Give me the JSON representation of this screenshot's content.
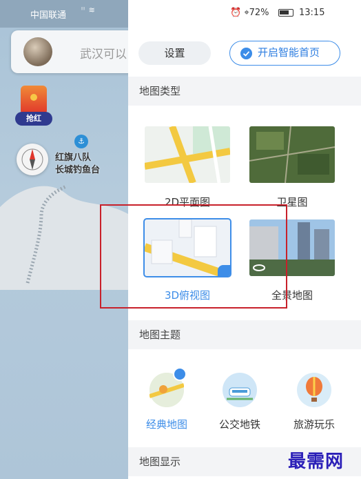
{
  "left_map": {
    "carrier": "中国联通",
    "network": "⁴ᴳ",
    "search_text": "武汉可以",
    "redpacket_label": "抢红",
    "poi_line1": "红旗八队",
    "poi_line2": "长城钓鱼台"
  },
  "status_bar": {
    "battery": "72%",
    "time": "13:15"
  },
  "header": {
    "settings_label": "设置",
    "smart_home_label": "开启智能首页"
  },
  "map_type": {
    "section_title": "地图类型",
    "options": [
      {
        "label": "2D平面图",
        "selected": false
      },
      {
        "label": "卫星图",
        "selected": false
      },
      {
        "label": "3D俯视图",
        "selected": true
      },
      {
        "label": "全景地图",
        "selected": false
      }
    ]
  },
  "map_theme": {
    "section_title": "地图主题",
    "options": [
      {
        "label": "经典地图",
        "selected": true
      },
      {
        "label": "公交地铁",
        "selected": false
      },
      {
        "label": "旅游玩乐",
        "selected": false
      }
    ]
  },
  "map_display": {
    "section_title": "地图显示"
  },
  "colors": {
    "accent": "#3d8de8",
    "annotation": "#c8202a",
    "watermark": "#2b1fb8"
  },
  "watermark": "最需网"
}
